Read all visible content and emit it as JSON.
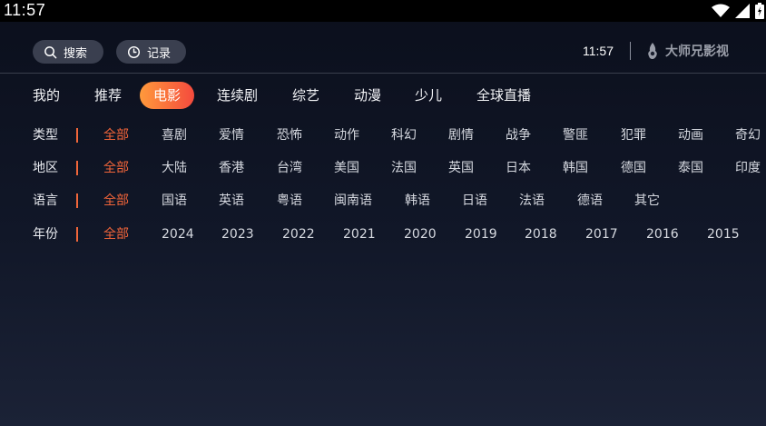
{
  "status_bar": {
    "time": "11:57"
  },
  "header": {
    "search_label": "搜索",
    "history_label": "记录",
    "clock": "11:57",
    "brand": "大师兄影视"
  },
  "tabs": [
    "我的",
    "推荐",
    "电影",
    "连续剧",
    "综艺",
    "动漫",
    "少儿",
    "全球直播"
  ],
  "active_tab": "电影",
  "filters": [
    {
      "label": "类型",
      "options": [
        "全部",
        "喜剧",
        "爱情",
        "恐怖",
        "动作",
        "科幻",
        "剧情",
        "战争",
        "警匪",
        "犯罪",
        "动画",
        "奇幻"
      ],
      "selected": "全部"
    },
    {
      "label": "地区",
      "options": [
        "全部",
        "大陆",
        "香港",
        "台湾",
        "美国",
        "法国",
        "英国",
        "日本",
        "韩国",
        "德国",
        "泰国",
        "印度"
      ],
      "selected": "全部"
    },
    {
      "label": "语言",
      "options": [
        "全部",
        "国语",
        "英语",
        "粤语",
        "闽南语",
        "韩语",
        "日语",
        "法语",
        "德语",
        "其它"
      ],
      "selected": "全部"
    },
    {
      "label": "年份",
      "options": [
        "全部",
        "2024",
        "2023",
        "2022",
        "2021",
        "2020",
        "2019",
        "2018",
        "2017",
        "2016",
        "2015"
      ],
      "selected": "全部"
    }
  ],
  "colors": {
    "accent_start": "#ff9a3c",
    "accent_end": "#f44a3d",
    "selected_text": "#f2653a"
  }
}
